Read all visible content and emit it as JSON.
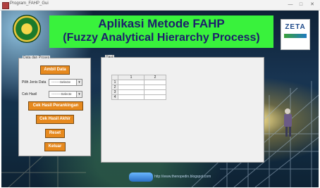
{
  "window": {
    "title": "Program_FAHP_Gui",
    "controls": [
      "—",
      "□",
      "✕"
    ]
  },
  "header": {
    "line1": "Aplikasi Metode FAHP",
    "line2": "(Fuzzy Analytical Hierarchy Process)",
    "right_logo_text": "ZETA"
  },
  "left_panel": {
    "caption": "Data dan Proses",
    "btn_ambil": "Ambil Data",
    "label_jenis": "Pilih Jenis Data",
    "combo_jenis": "--------Selecte",
    "label_cek": "Cek Hasil",
    "combo_cek": "---------Selecte",
    "btn_perankingan": "Cek Hasil Perankingan",
    "btn_akhir": "Cek Hasil Akhir",
    "btn_reset": "Reset",
    "btn_keluar": "Keluar"
  },
  "result_panel": {
    "caption": "Hasil",
    "columns": [
      "1",
      "2"
    ],
    "rows": [
      "1",
      "2",
      "3",
      "4"
    ]
  },
  "footer": {
    "text": "http://www.thenopedin.blogspot.com"
  }
}
